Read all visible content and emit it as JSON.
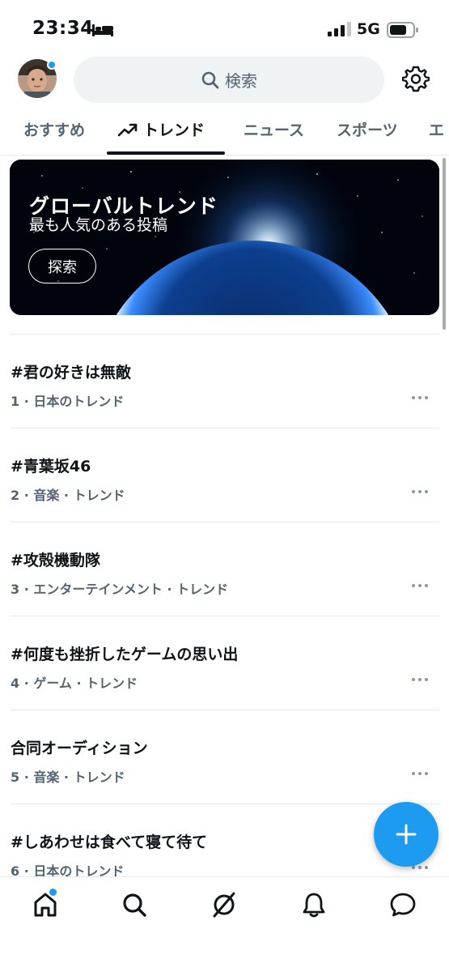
{
  "status_bar": {
    "time": "23:34",
    "network": "5G"
  },
  "header": {
    "search_placeholder": "検索"
  },
  "tabs": [
    {
      "label": "おすすめ"
    },
    {
      "label": "トレンド"
    },
    {
      "label": "ニュース"
    },
    {
      "label": "スポーツ"
    },
    {
      "label": "エ"
    }
  ],
  "banner": {
    "title": "グローバルトレンド",
    "subtitle": "最も人気のある投稿",
    "button_label": "探索"
  },
  "trends": [
    {
      "title": "#君の好きは無敵",
      "meta": "1 · 日本のトレンド"
    },
    {
      "title": "#青葉坂46",
      "meta": "2 · 音楽 · トレンド"
    },
    {
      "title": "#攻殻機動隊",
      "meta": "3 · エンターテインメント · トレンド"
    },
    {
      "title": "#何度も挫折したゲームの思い出",
      "meta": "4 · ゲーム · トレンド"
    },
    {
      "title": "合同オーディション",
      "meta": "5 · 音楽 · トレンド"
    },
    {
      "title": "#しあわせは食べて寝て待て",
      "meta": "6 · 日本のトレンド"
    }
  ],
  "colors": {
    "accent": "#1d9bf0",
    "secondary_text": "#536471",
    "primary_text": "#0f1419"
  }
}
